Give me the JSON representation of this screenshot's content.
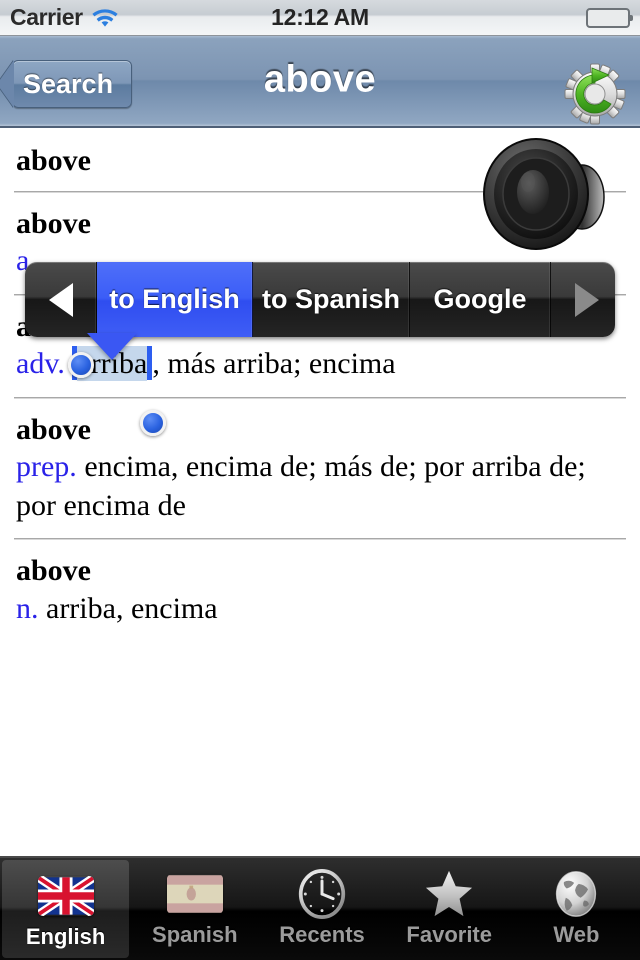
{
  "status_bar": {
    "carrier": "Carrier",
    "wifi_icon": "wifi-icon",
    "time": "12:12 AM",
    "battery_icon": "battery-icon"
  },
  "nav_bar": {
    "back_label": "Search",
    "title": "above",
    "refresh_icon": "gear-refresh-icon"
  },
  "content": {
    "speaker_icon": "speaker-icon",
    "entries": [
      {
        "headword": "above",
        "pos": "",
        "definition": ""
      },
      {
        "headword": "above",
        "pos": "a",
        "definition": ""
      },
      {
        "headword": "above",
        "pos": "adv.",
        "selected_word": "arriba",
        "definition_rest": ", más arriba; encima"
      },
      {
        "headword": "above",
        "pos": "prep.",
        "definition": "encima, encima de; más de; por arriba de; por encima de"
      },
      {
        "headword": "above",
        "pos": "n.",
        "definition": "arriba, encima"
      }
    ]
  },
  "popup_menu": {
    "prev_arrow_icon": "triangle-left-icon",
    "next_arrow_icon": "triangle-right-icon",
    "items": [
      {
        "label": "to English",
        "selected": true
      },
      {
        "label": "to Spanish",
        "selected": false
      },
      {
        "label": "Google",
        "selected": false
      }
    ]
  },
  "tab_bar": {
    "items": [
      {
        "label": "English",
        "icon": "uk-flag-icon",
        "selected": true
      },
      {
        "label": "Spanish",
        "icon": "spain-flag-icon",
        "selected": false
      },
      {
        "label": "Recents",
        "icon": "clock-icon",
        "selected": false
      },
      {
        "label": "Favorite",
        "icon": "star-icon",
        "selected": false
      },
      {
        "label": "Web",
        "icon": "globe-icon",
        "selected": false
      }
    ]
  },
  "colors": {
    "accent_blue": "#2a22e8",
    "selection_blue": "#2d5ef0",
    "selection_fill": "#c5d7ec",
    "nav_blue": "#7c94b2",
    "battery_green": "#63c52c"
  }
}
